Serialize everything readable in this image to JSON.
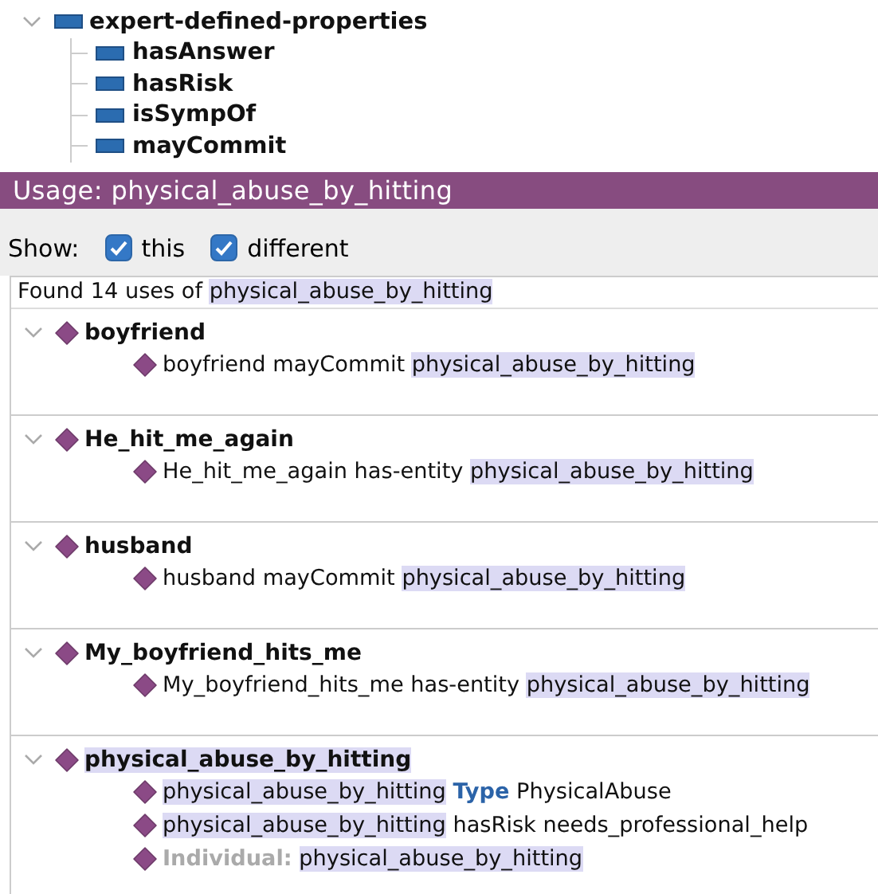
{
  "tree": {
    "label": "expert-defined-properties",
    "expanded": true,
    "children": [
      {
        "label": "hasAnswer"
      },
      {
        "label": "hasRisk"
      },
      {
        "label": "isSympOf"
      },
      {
        "label": "mayCommit"
      }
    ]
  },
  "usage": {
    "title": "Usage: physical_abuse_by_hitting",
    "show_label": "Show:",
    "filters": [
      {
        "label": "this",
        "checked": true
      },
      {
        "label": "different",
        "checked": true
      }
    ],
    "found": [
      {
        "kind": "plain",
        "text": "Found 14 uses of"
      },
      {
        "kind": "highlight",
        "text": "physical_abuse_by_hitting"
      }
    ],
    "groups": [
      {
        "name": "boyfriend",
        "highlight": false,
        "expanded": true,
        "uses": [
          [
            {
              "kind": "plain",
              "text": "boyfriend mayCommit"
            },
            {
              "kind": "highlight",
              "text": "physical_abuse_by_hitting"
            }
          ]
        ]
      },
      {
        "name": "He_hit_me_again",
        "highlight": false,
        "expanded": true,
        "uses": [
          [
            {
              "kind": "plain",
              "text": "He_hit_me_again has-entity"
            },
            {
              "kind": "highlight",
              "text": "physical_abuse_by_hitting"
            }
          ]
        ]
      },
      {
        "name": "husband",
        "highlight": false,
        "expanded": true,
        "uses": [
          [
            {
              "kind": "plain",
              "text": "husband mayCommit"
            },
            {
              "kind": "highlight",
              "text": "physical_abuse_by_hitting"
            }
          ]
        ]
      },
      {
        "name": "My_boyfriend_hits_me",
        "highlight": false,
        "expanded": true,
        "uses": [
          [
            {
              "kind": "plain",
              "text": "My_boyfriend_hits_me has-entity"
            },
            {
              "kind": "highlight",
              "text": "physical_abuse_by_hitting"
            }
          ]
        ]
      },
      {
        "name": "physical_abuse_by_hitting",
        "highlight": true,
        "expanded": true,
        "uses": [
          [
            {
              "kind": "highlight",
              "text": "physical_abuse_by_hitting"
            },
            {
              "kind": "keyword",
              "text": "Type"
            },
            {
              "kind": "plain",
              "text": "PhysicalAbuse"
            }
          ],
          [
            {
              "kind": "highlight",
              "text": "physical_abuse_by_hitting"
            },
            {
              "kind": "plain",
              "text": "hasRisk needs_professional_help"
            }
          ],
          [
            {
              "kind": "label",
              "text": "Individual:"
            },
            {
              "kind": "highlight",
              "text": "physical_abuse_by_hitting"
            }
          ]
        ]
      }
    ]
  }
}
